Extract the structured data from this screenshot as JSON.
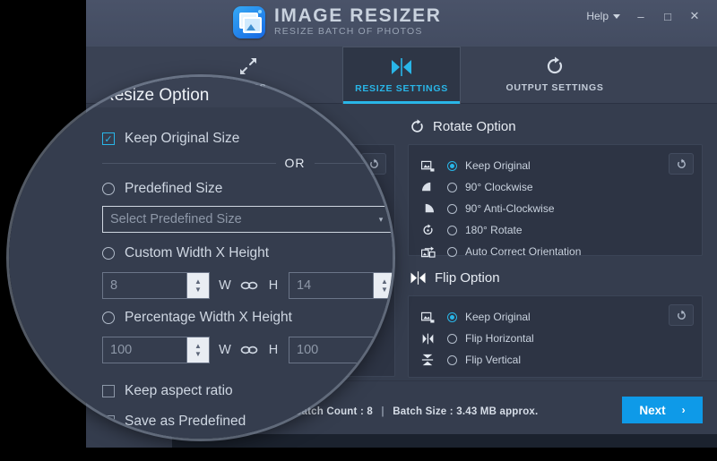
{
  "titlebar": {
    "app_name": "IMAGE RESIZER",
    "tagline": "RESIZE BATCH OF PHOTOS",
    "help_label": "Help",
    "minimize": "–",
    "maximize": "□",
    "close": "✕",
    "logo_icon": "image-resizer-logo"
  },
  "tabs": [
    {
      "label": "HOTOS",
      "icon": "expand-arrows-icon",
      "active": false
    },
    {
      "label": "RESIZE SETTINGS",
      "icon": "resize-arrows-icon",
      "active": true
    },
    {
      "label": "OUTPUT SETTINGS",
      "icon": "rotate-refresh-icon",
      "active": false
    }
  ],
  "resize_option": {
    "title": "Resize Option",
    "keep_original_size": {
      "label": "Keep Original Size",
      "checked": true
    },
    "or_label": "OR",
    "predefined_size": {
      "label": "Predefined Size",
      "selected": false
    },
    "predefined_select": {
      "placeholder": "Select Predefined Size",
      "value": "",
      "caret": "▾"
    },
    "custom": {
      "label": "Custom Width X Height",
      "selected": false,
      "width_value": "8",
      "height_value": "14",
      "w_label": "W",
      "h_label": "H",
      "link_icon": "chain-link-icon"
    },
    "percentage": {
      "label": "Percentage Width X Height",
      "selected": false,
      "width_value": "100",
      "height_value": "100",
      "w_label": "W",
      "h_label": "H",
      "link_icon": "chain-link-icon"
    },
    "keep_aspect_ratio": {
      "label": "Keep aspect ratio",
      "checked": false
    },
    "save_as_predefined": {
      "label": "Save as Predefined",
      "checked": false
    },
    "reset_icon": "reset-arrow-icon"
  },
  "rotate_option": {
    "title": "Rotate Option",
    "header_icon": "rotate-refresh-icon",
    "reset_icon": "reset-arrow-icon",
    "items": [
      {
        "label": "Keep Original",
        "icon": "keep-original-icon",
        "selected": true
      },
      {
        "label": "90° Clockwise",
        "icon": "rotate-90-cw-icon",
        "selected": false
      },
      {
        "label": "90° Anti-Clockwise",
        "icon": "rotate-90-ccw-icon",
        "selected": false
      },
      {
        "label": "180° Rotate",
        "icon": "rotate-180-icon",
        "selected": false
      },
      {
        "label": "Auto Correct Orientation",
        "icon": "auto-orientation-icon",
        "selected": false
      }
    ]
  },
  "flip_option": {
    "title": "Flip Option",
    "header_icon": "flip-icon",
    "reset_icon": "reset-arrow-icon",
    "items": [
      {
        "label": "Keep Original",
        "icon": "keep-original-icon",
        "selected": true
      },
      {
        "label": "Flip Horizontal",
        "icon": "flip-horizontal-icon",
        "selected": false
      },
      {
        "label": "Flip Vertical",
        "icon": "flip-vertical-icon",
        "selected": false
      }
    ]
  },
  "footer": {
    "batch_count_label": "Batch Count :",
    "batch_count_value": "8",
    "separator": "|",
    "batch_size_label": "Batch Size :",
    "batch_size_value": "3.43 MB approx.",
    "next_label": "Next",
    "next_arrow": "›"
  },
  "colors": {
    "accent": "#29b6e8",
    "next_button": "#0e9ae8",
    "window_bg": "#353d4e",
    "panel_bg": "#2d3444",
    "titlebar": "#4a5369"
  }
}
